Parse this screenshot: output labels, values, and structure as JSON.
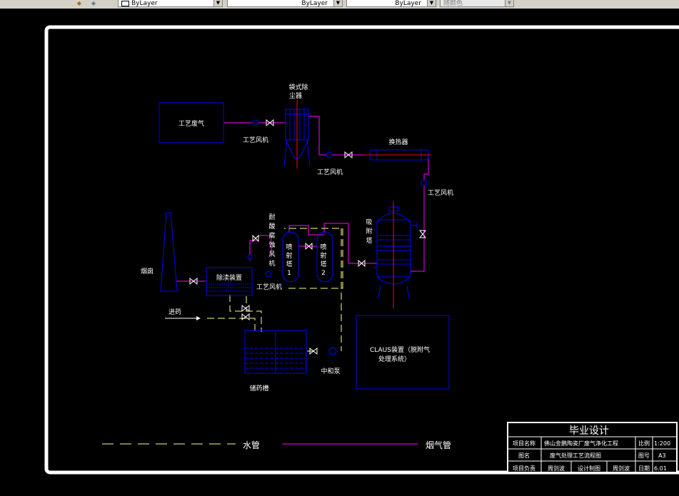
{
  "toolbar": {
    "icons": [
      "layer-state-icon",
      "layer-previous-icon"
    ],
    "color_combo": "ByLayer",
    "linetype_combo": "ByLayer",
    "lineweight_combo": "ByLayer",
    "plotstyle_combo": "随颜色"
  },
  "colors": {
    "background": "#000000",
    "frame": "#ffffff",
    "equipment": "#0000ff",
    "gas_pipe": "#ff00ff",
    "water_pipe": "#ffff80",
    "text": "#ffffff",
    "valve": "#ffffff",
    "axis_line": "#ff0000"
  },
  "drawing": {
    "process_gas_box": "工艺废气",
    "bag_filter_label_1": "袋式除",
    "bag_filter_label_2": "尘器",
    "fan_1": "工艺风机",
    "fan_2": "工艺风机",
    "heat_exchanger": "换热器",
    "fan_3": "工艺风机",
    "adsorption_tower_label": [
      "吸",
      "附",
      "塔"
    ],
    "acid_fan_label": [
      "耐",
      "酸",
      "腐",
      "蚀",
      "风",
      "机"
    ],
    "jet_tower_1": [
      "喷",
      "射",
      "塔",
      "1"
    ],
    "jet_tower_2": [
      "喷",
      "射",
      "塔",
      "2"
    ],
    "chimney": "烟囱",
    "dust_removal": "除渎装置",
    "fan_4": "工艺风机",
    "chemical_inlet": "进药",
    "claus_line_1": "CLAUS装置（脱附气",
    "claus_line_2": "处理系统）",
    "neutralization_pump": "中和泵",
    "storage_tank": "储药槽"
  },
  "legend": {
    "water_pipe": "水管",
    "gas_pipe": "烟气管"
  },
  "title_block": {
    "title": "毕业设计",
    "row1_label": "项目名称",
    "row1_value": "佛山金鹏陶瓷厂废气净化工程",
    "row1_key": "比例",
    "row1_keyval": "1:200",
    "row2_label": "图名",
    "row2_value": "废气处理工艺流程图",
    "row2_key": "图号",
    "row2_keyval": "A3",
    "row3_a": "项目负责",
    "row3_b": "周剑波",
    "row3_c": "设计制图",
    "row3_d": "周剑波",
    "row3_e": "日期",
    "row3_f": "6.01"
  }
}
